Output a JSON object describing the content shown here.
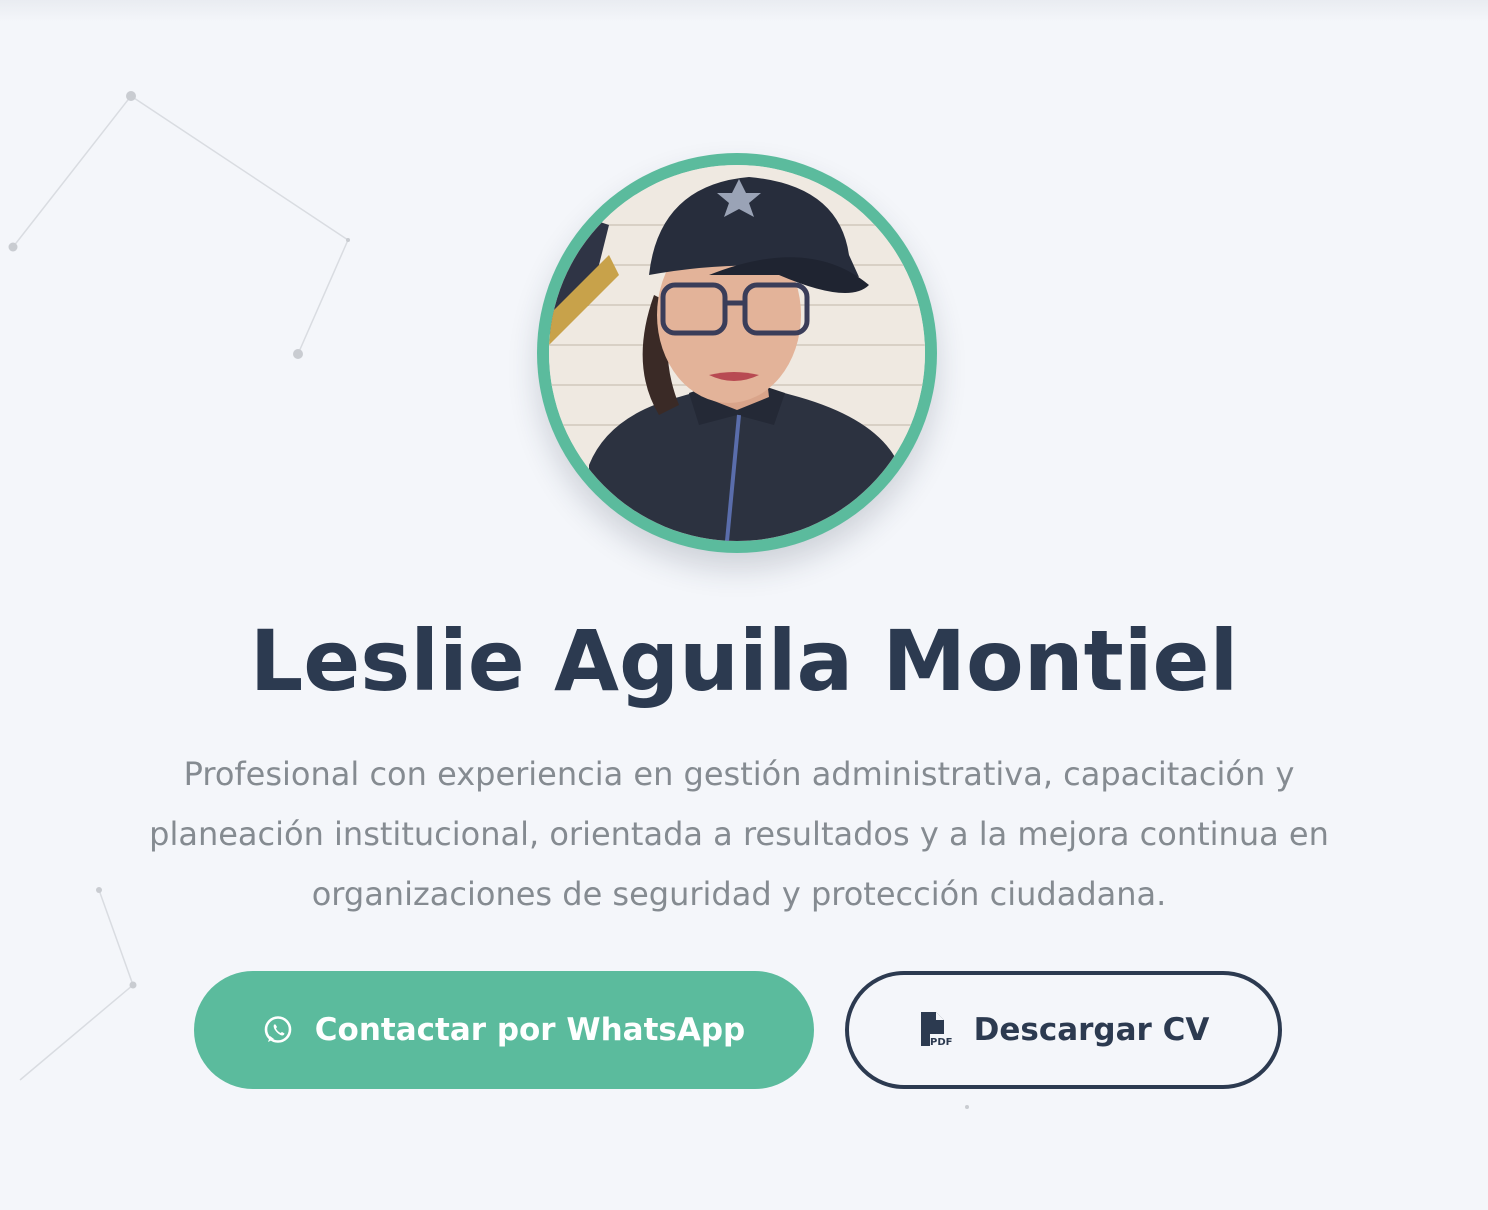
{
  "profile": {
    "name": "Leslie Aguila Montiel",
    "bio": "Profesional con experiencia en gestión administrativa, capacitación y planeación institucional, orientada a resultados y a la mejora continua en organizaciones de seguridad y protección ciudadana.",
    "photo_icon": "profile-photo"
  },
  "actions": {
    "whatsapp_label": "Contactar por WhatsApp",
    "whatsapp_icon": "whatsapp-icon",
    "cv_label": "Descargar CV",
    "cv_icon": "pdf-file-icon"
  },
  "colors": {
    "background": "#f4f6fa",
    "accent": "#5bbb9d",
    "heading": "#2c3a50",
    "body_text": "#858b91"
  }
}
